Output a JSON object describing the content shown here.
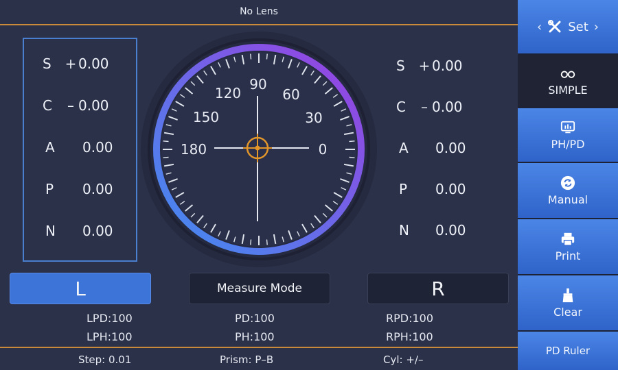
{
  "header": {
    "title": "No Lens"
  },
  "left": [
    {
      "label": "S",
      "sign": "+",
      "value": "0.00"
    },
    {
      "label": "C",
      "sign": "–",
      "value": "0.00"
    },
    {
      "label": "A",
      "sign": "",
      "value": "0.00"
    },
    {
      "label": "P",
      "sign": "",
      "value": "0.00"
    },
    {
      "label": "N",
      "sign": "",
      "value": "0.00"
    }
  ],
  "right": [
    {
      "label": "S",
      "sign": "+",
      "value": "0.00"
    },
    {
      "label": "C",
      "sign": "–",
      "value": "0.00"
    },
    {
      "label": "A",
      "sign": "",
      "value": "0.00"
    },
    {
      "label": "P",
      "sign": "",
      "value": "0.00"
    },
    {
      "label": "N",
      "sign": "",
      "value": "0.00"
    }
  ],
  "dial": {
    "labels": [
      "0",
      "30",
      "60",
      "90",
      "120",
      "150",
      "180"
    ]
  },
  "buttons": {
    "left": "L",
    "mode": "Measure Mode",
    "right": "R"
  },
  "info": {
    "lpd": "LPD:100",
    "pd": "PD:100",
    "rpd": "RPD:100",
    "lph": "LPH:100",
    "ph": "PH:100",
    "rph": "RPH:100"
  },
  "footer": {
    "step": "Step: 0.01",
    "prism": "Prism: P–B",
    "cyl": "Cyl: +/–"
  },
  "sidebar": {
    "set": {
      "label": "Set",
      "prev": "‹",
      "next": "›"
    },
    "items": [
      {
        "label": "SIMPLE",
        "icon": "glasses-icon"
      },
      {
        "label": "PH/PD",
        "icon": "chart-monitor-icon"
      },
      {
        "label": "Manual",
        "icon": "refresh-icon"
      },
      {
        "label": "Print",
        "icon": "printer-icon"
      },
      {
        "label": "Clear",
        "icon": "brush-icon"
      },
      {
        "label": "PD Ruler"
      }
    ]
  },
  "colors": {
    "accent": "#3c74d8",
    "orange": "#e3962a",
    "ring_start": "#3f8ef0",
    "ring_end": "#9b3fe0"
  }
}
